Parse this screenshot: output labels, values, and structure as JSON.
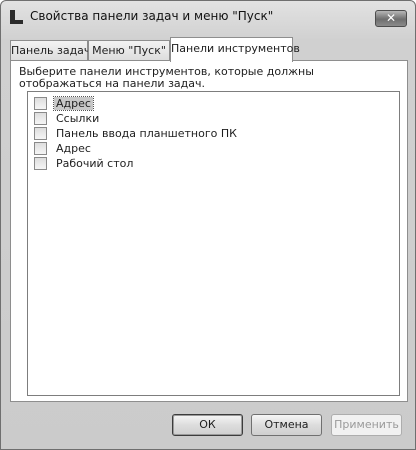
{
  "window": {
    "title": "Свойства панели задач и меню \"Пуск\"",
    "close_glyph": "✕"
  },
  "tabs": [
    {
      "label": "Панель задач",
      "active": false
    },
    {
      "label": "Меню \"Пуск\"",
      "active": false
    },
    {
      "label": "Панели инструментов",
      "active": true
    }
  ],
  "toolbars_tab": {
    "description": "Выберите панели инструментов, которые должны отображаться на панели задач.",
    "items": [
      {
        "label": "Адрес",
        "checked": false,
        "selected": true
      },
      {
        "label": "Ссылки",
        "checked": false,
        "selected": false
      },
      {
        "label": "Панель ввода планшетного ПК",
        "checked": false,
        "selected": false
      },
      {
        "label": "Адрес",
        "checked": false,
        "selected": false
      },
      {
        "label": "Рабочий стол",
        "checked": false,
        "selected": false
      }
    ]
  },
  "buttons": {
    "ok": "ОК",
    "cancel": "Отмена",
    "apply": "Применить"
  }
}
